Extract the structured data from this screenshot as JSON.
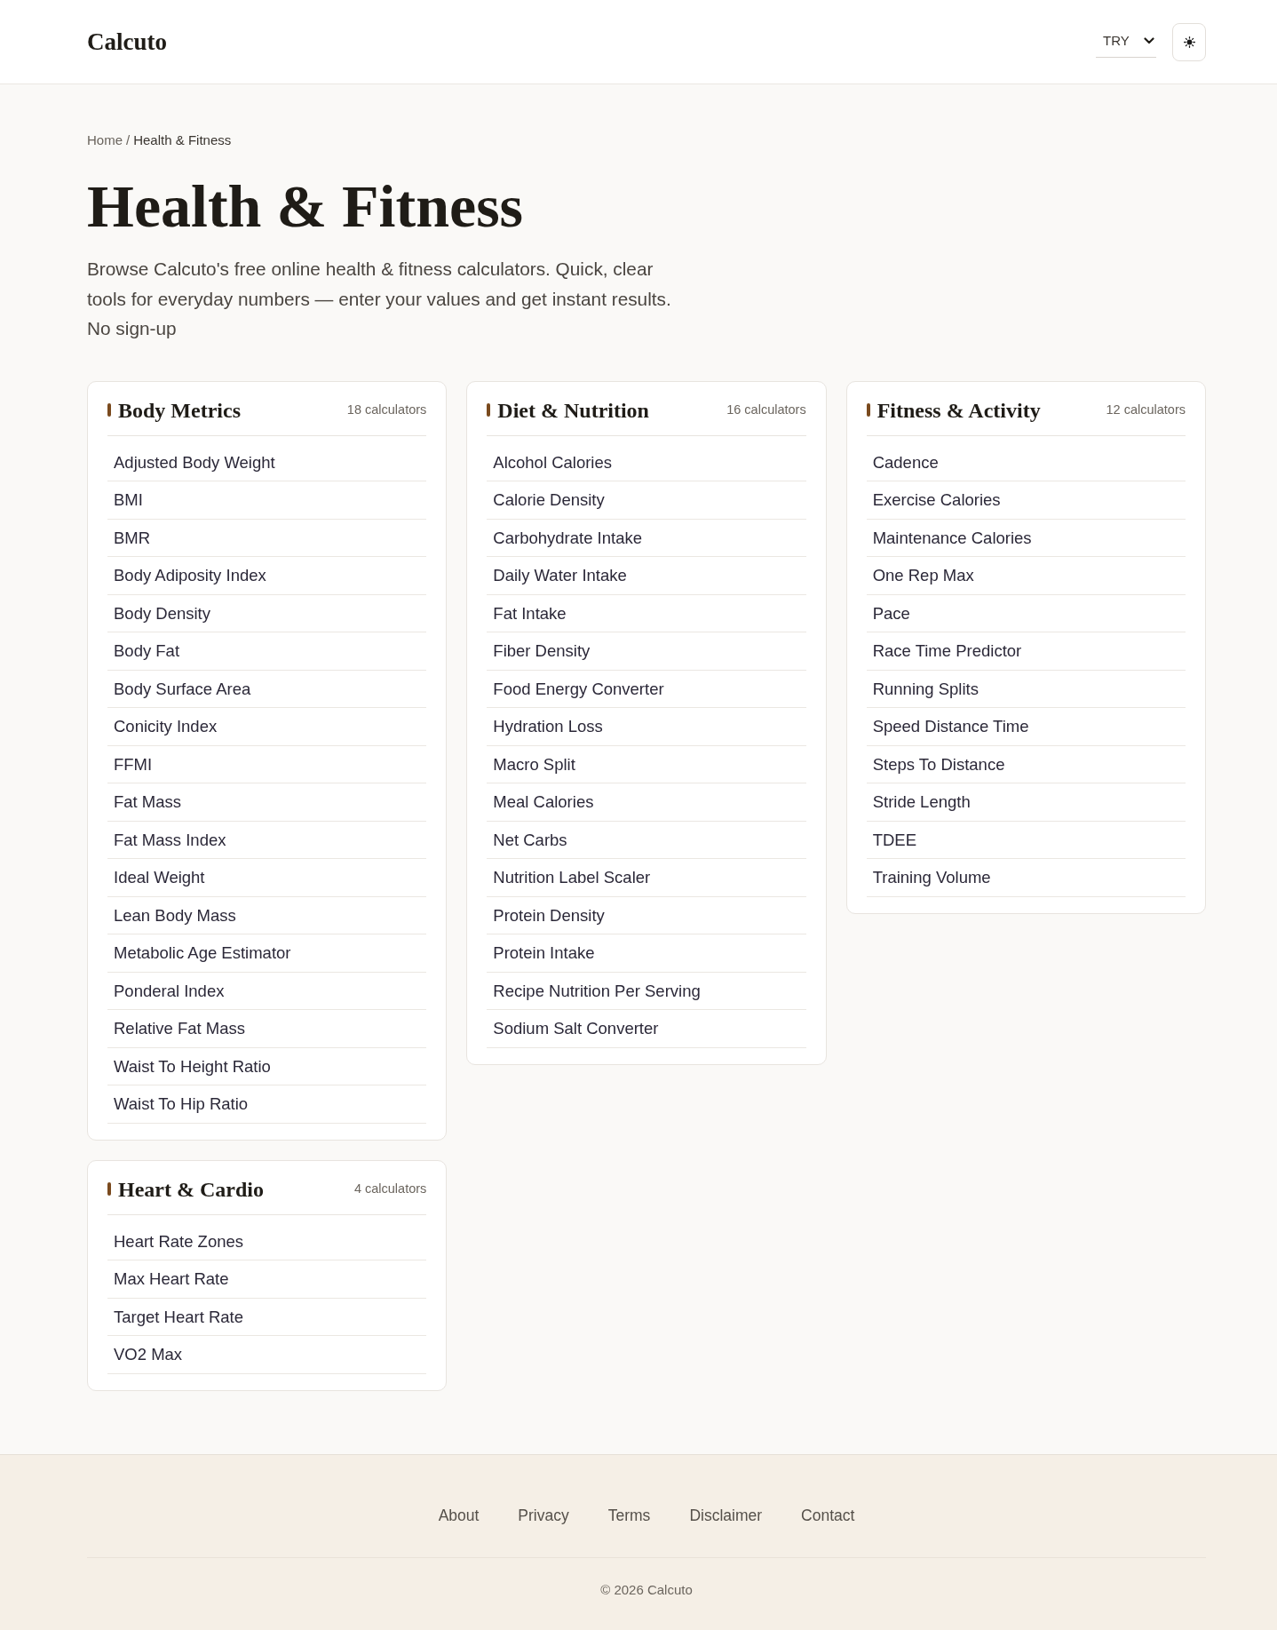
{
  "header": {
    "logo": "Calcuto",
    "currency": "TRY"
  },
  "breadcrumb": {
    "separator": "/",
    "items": [
      {
        "label": "Home",
        "current": false
      },
      {
        "label": "Health & Fitness",
        "current": true
      }
    ]
  },
  "page": {
    "title": "Health & Fitness",
    "intro": "Browse Calcuto's free online health & fitness calculators. Quick, clear tools for everyday numbers — enter your values and get instant results. No sign-up"
  },
  "categories": [
    {
      "title": "Body Metrics",
      "count": "18 calculators",
      "items": [
        "Adjusted Body Weight",
        "BMI",
        "BMR",
        "Body Adiposity Index",
        "Body Density",
        "Body Fat",
        "Body Surface Area",
        "Conicity Index",
        "FFMI",
        "Fat Mass",
        "Fat Mass Index",
        "Ideal Weight",
        "Lean Body Mass",
        "Metabolic Age Estimator",
        "Ponderal Index",
        "Relative Fat Mass",
        "Waist To Height Ratio",
        "Waist To Hip Ratio"
      ]
    },
    {
      "title": "Diet & Nutrition",
      "count": "16 calculators",
      "items": [
        "Alcohol Calories",
        "Calorie Density",
        "Carbohydrate Intake",
        "Daily Water Intake",
        "Fat Intake",
        "Fiber Density",
        "Food Energy Converter",
        "Hydration Loss",
        "Macro Split",
        "Meal Calories",
        "Net Carbs",
        "Nutrition Label Scaler",
        "Protein Density",
        "Protein Intake",
        "Recipe Nutrition Per Serving",
        "Sodium Salt Converter"
      ]
    },
    {
      "title": "Fitness & Activity",
      "count": "12 calculators",
      "items": [
        "Cadence",
        "Exercise Calories",
        "Maintenance Calories",
        "One Rep Max",
        "Pace",
        "Race Time Predictor",
        "Running Splits",
        "Speed Distance Time",
        "Steps To Distance",
        "Stride Length",
        "TDEE",
        "Training Volume"
      ]
    },
    {
      "title": "Heart & Cardio",
      "count": "4 calculators",
      "items": [
        "Heart Rate Zones",
        "Max Heart Rate",
        "Target Heart Rate",
        "VO2 Max"
      ]
    }
  ],
  "footer": {
    "links": [
      "About",
      "Privacy",
      "Terms",
      "Disclaimer",
      "Contact"
    ],
    "copyright": "© 2026 Calcuto"
  }
}
